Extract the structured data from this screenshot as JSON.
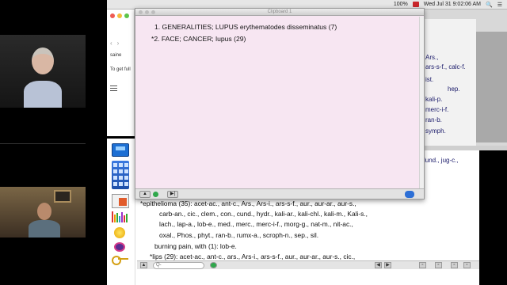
{
  "menubar": {
    "battery": "100%",
    "datetime": "Wed Jul 31  9:02:06 AM"
  },
  "dialog": {
    "window_title": "Clipboard 1",
    "results": [
      "1. GENERALITIES; LUPUS erythematodes disseminatus (7)",
      "*2. FACE; CANCER; lupus (29)"
    ]
  },
  "browser": {
    "lines": [
      "saine",
      "To get full"
    ]
  },
  "repertory": {
    "right_column": [
      "Ars.,",
      "ars-s-f., calc-f.",
      "ist.",
      "hep.",
      "kali-p.",
      "merc-i-f.",
      "ran-b.",
      "symph."
    ],
    "right_fragment": "lund., jug-c.,",
    "lines": [
      "*epithelioma (35): acet-ac., ant-c., Ars., Ars-i., ars-s-f., aur., aur-ar., aur-s.,",
      "carb-an., cic., clem., con., cund., hydr., kali-ar., kali-chl., kali-m., Kali-s.,",
      "lach., lap-a., lob-e., med., merc., merc-i-f., morg-g., nat-m., nit-ac.,",
      "oxal., Phos., phyt., ran-b., rumx-a., scroph-n., sep., sil.",
      "burning pain, with (1): lob-e.",
      "*lips (29): acet-ac., ant-c., ars., Ars-i., ars-s-f., aur., aur-ar., aur-s., cic.,"
    ],
    "search_placeholder": "Q-"
  },
  "colors": {
    "dialog_bg": "#f7e6f2",
    "remedy_blue": "#1b1b7a",
    "menubar_bg": "#e6e6e6"
  }
}
